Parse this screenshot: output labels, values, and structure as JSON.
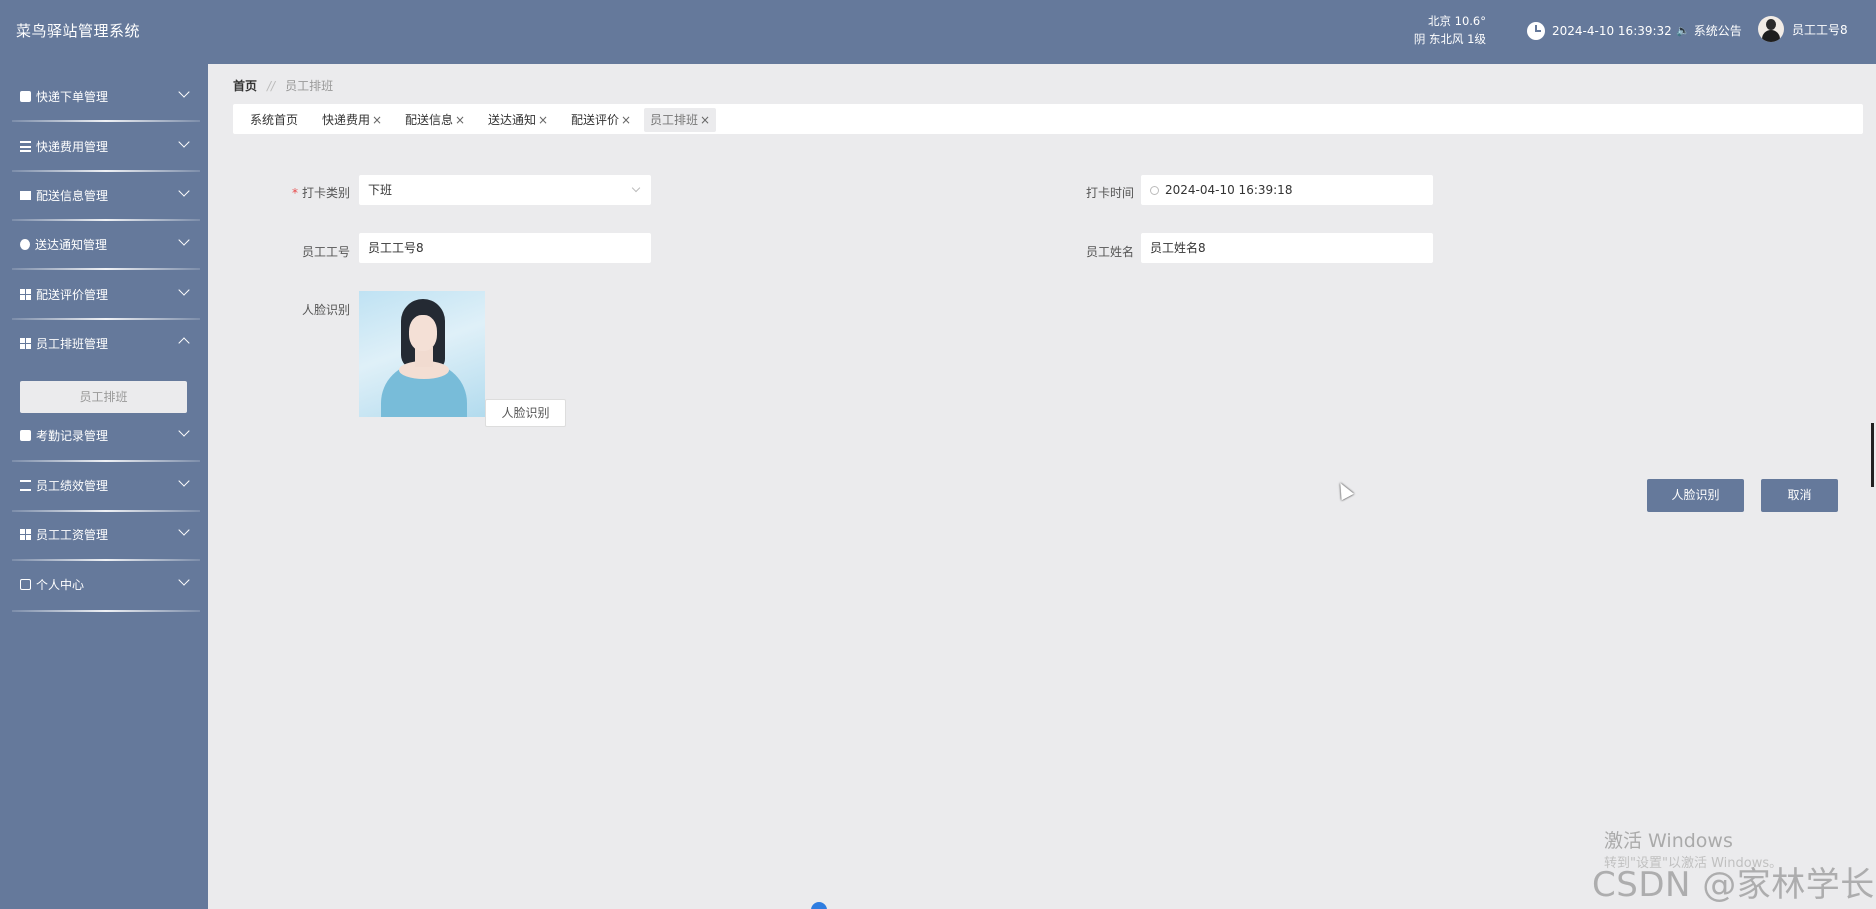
{
  "header": {
    "title": "菜鸟驿站管理系统",
    "weather_city": "北京  10.6°",
    "weather_desc": "阴  东北风  1级",
    "datetime": "2024-4-10 16:39:32",
    "notice_label": "系统公告",
    "username": "员工工号8"
  },
  "sidebar": {
    "items": [
      {
        "label": "快递下单管理",
        "icon": "box-icon"
      },
      {
        "label": "快递费用管理",
        "icon": "list-icon"
      },
      {
        "label": "配送信息管理",
        "icon": "monitor-icon"
      },
      {
        "label": "送达通知管理",
        "icon": "bulb-icon"
      },
      {
        "label": "配送评价管理",
        "icon": "grid-icon"
      },
      {
        "label": "员工排班管理",
        "icon": "grid-icon"
      },
      {
        "label": "考勤记录管理",
        "icon": "box-icon"
      },
      {
        "label": "员工绩效管理",
        "icon": "sliders-icon"
      },
      {
        "label": "员工工资管理",
        "icon": "grid-icon"
      },
      {
        "label": "个人中心",
        "icon": "card-icon"
      }
    ],
    "active_sub": "员工排班"
  },
  "breadcrumb": {
    "home": "首页",
    "separator": "//",
    "current": "员工排班"
  },
  "tabs": [
    {
      "label": "系统首页",
      "closable": false
    },
    {
      "label": "快递费用",
      "closable": true
    },
    {
      "label": "配送信息",
      "closable": true
    },
    {
      "label": "送达通知",
      "closable": true
    },
    {
      "label": "配送评价",
      "closable": true
    },
    {
      "label": "员工排班",
      "closable": true,
      "active": true
    }
  ],
  "tab_close_glyph": "×",
  "form": {
    "punch_type_label": "打卡类别",
    "punch_type_value": "下班",
    "punch_time_label": "打卡时间",
    "punch_time_value": "2024-04-10 16:39:18",
    "emp_no_label": "员工工号",
    "emp_no_value": "员工工号8",
    "emp_name_label": "员工姓名",
    "emp_name_value": "员工姓名8",
    "face_label": "人脸识别",
    "face_button": "人脸识别",
    "required_mark": "*"
  },
  "actions": {
    "face_recognize": "人脸识别",
    "cancel": "取消"
  },
  "watermarks": {
    "activate_windows": "激活 Windows",
    "activate_sub": "转到\"设置\"以激活 Windows。",
    "csdn": "CSDN @家林学长"
  },
  "colors": {
    "primary": "#65799b",
    "background": "#ebebed",
    "required": "#e84a4a"
  }
}
